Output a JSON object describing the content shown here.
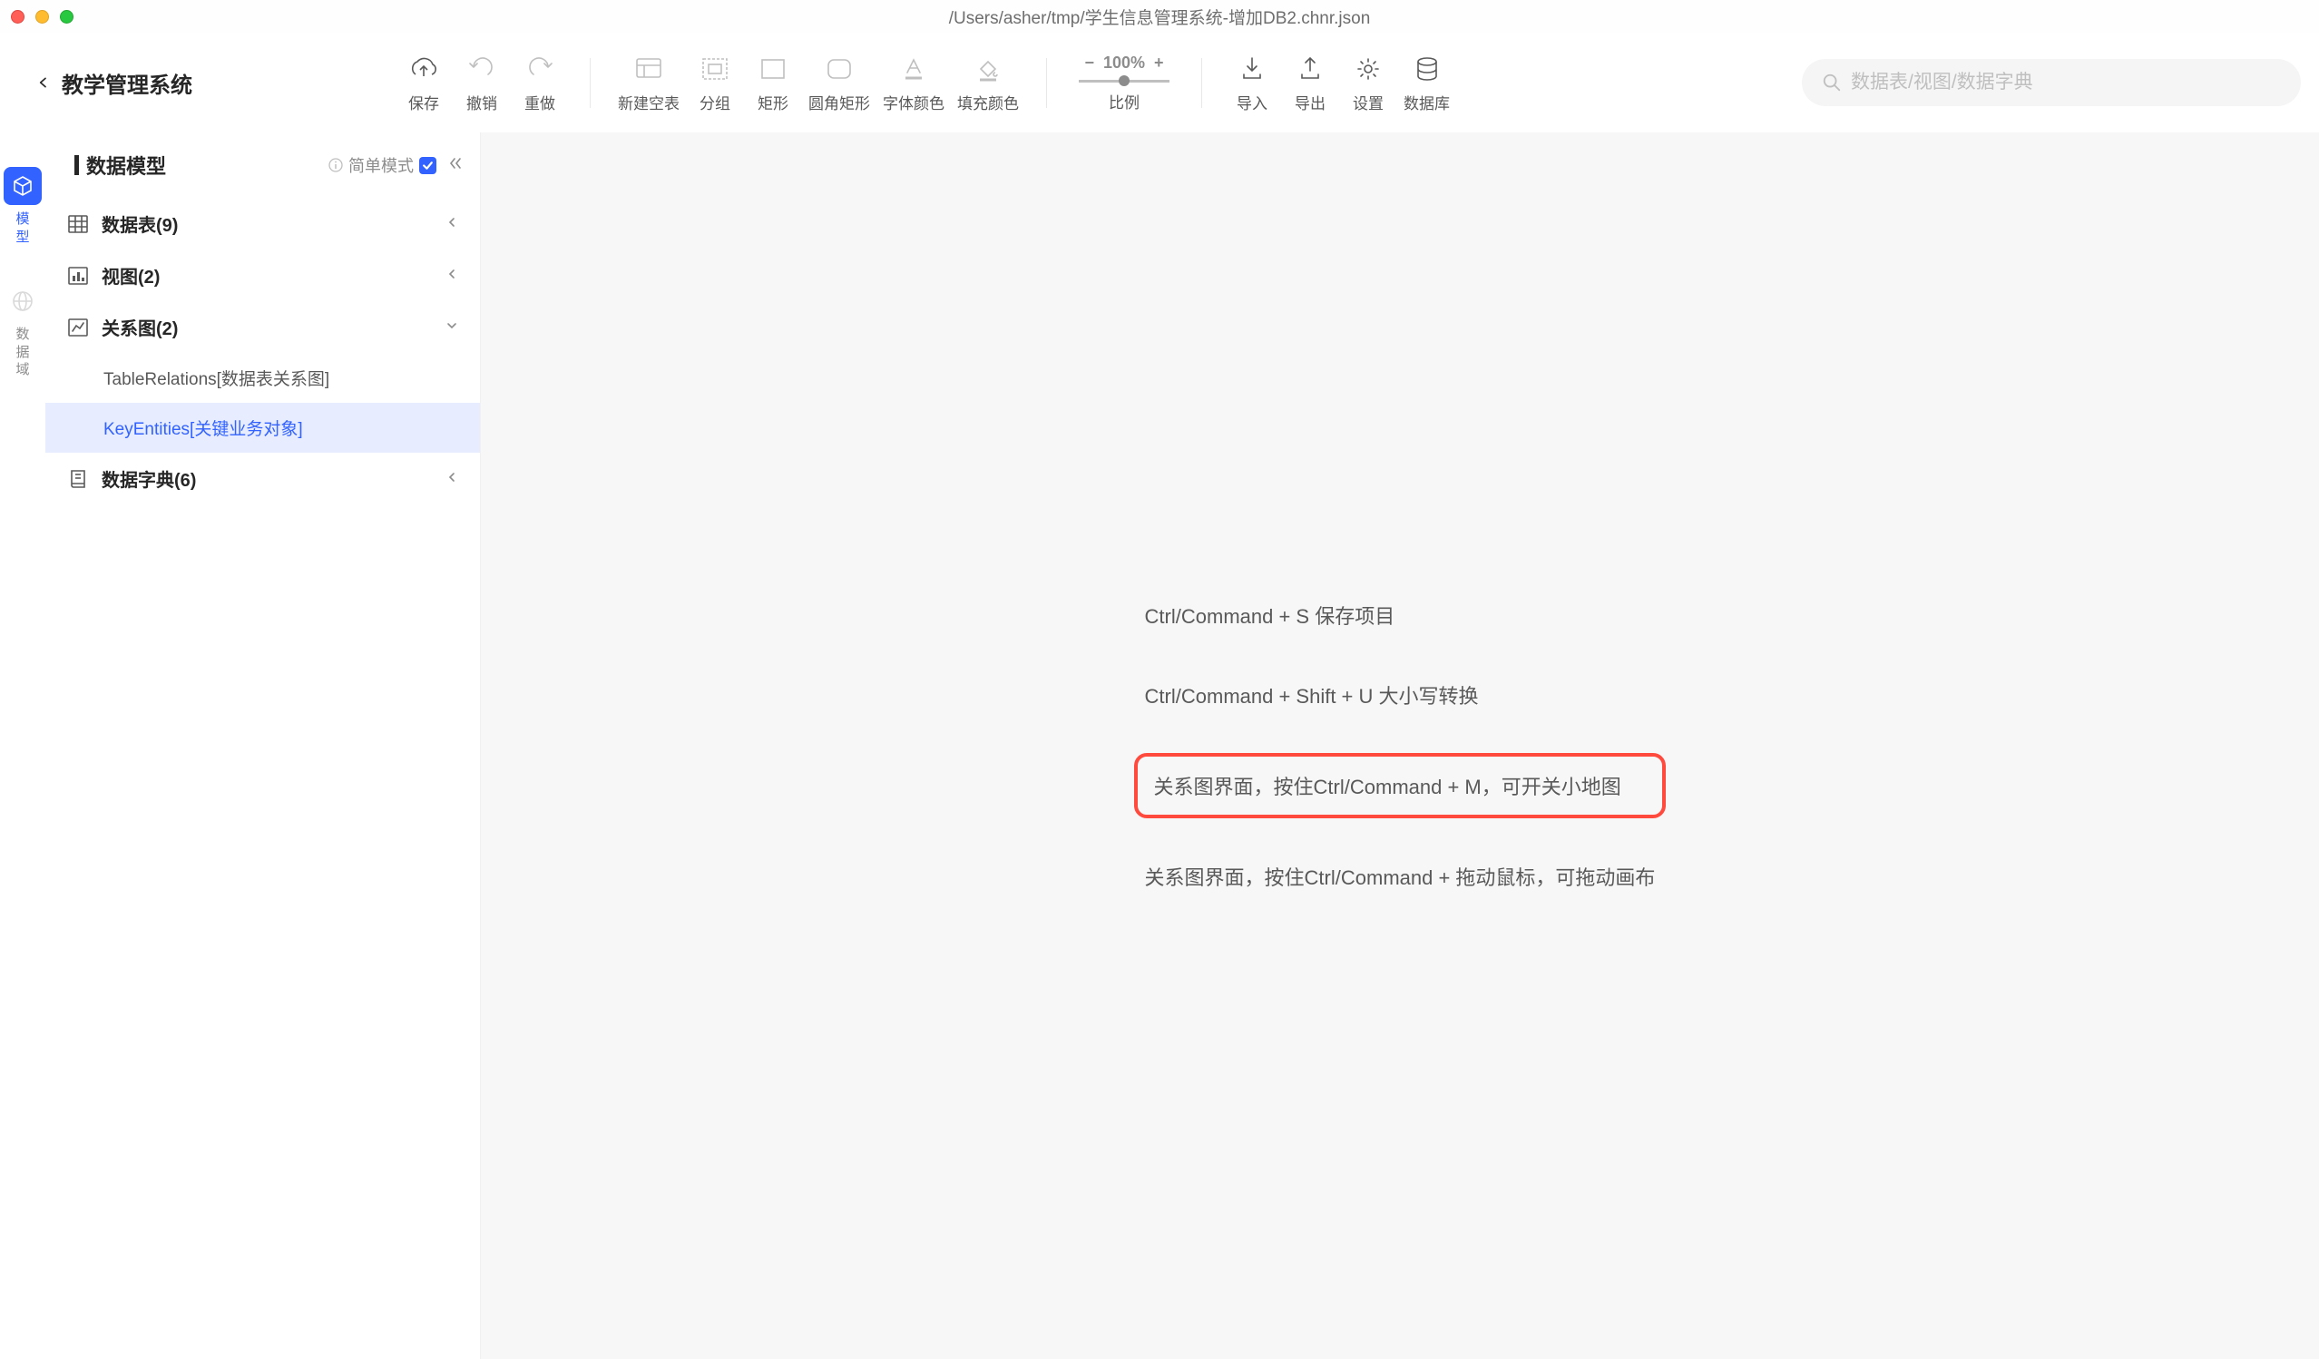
{
  "window": {
    "title": "/Users/asher/tmp/学生信息管理系统-增加DB2.chnr.json"
  },
  "project": {
    "name": "教学管理系统"
  },
  "toolbar": {
    "save": "保存",
    "undo": "撤销",
    "redo": "重做",
    "new_table": "新建空表",
    "group": "分组",
    "rect": "矩形",
    "round_rect": "圆角矩形",
    "font_color": "字体颜色",
    "fill_color": "填充颜色",
    "zoom": {
      "value": "100%",
      "label": "比例",
      "minus": "−",
      "plus": "+"
    },
    "import": "导入",
    "export": "导出",
    "settings": "设置",
    "database": "数据库"
  },
  "search": {
    "placeholder": "数据表/视图/数据字典"
  },
  "left_rail": {
    "model": "模\n型",
    "domain": "数\n据\n域"
  },
  "sidebar": {
    "title": "数据模型",
    "simple_mode_label": "简单模式",
    "tree": {
      "tables": {
        "label": "数据表(9)"
      },
      "views": {
        "label": "视图(2)"
      },
      "relations": {
        "label": "关系图(2)",
        "children": [
          {
            "label": "TableRelations[数据表关系图]",
            "selected": false
          },
          {
            "label": "KeyEntities[关键业务对象]",
            "selected": true
          }
        ]
      },
      "dicts": {
        "label": "数据字典(6)"
      }
    }
  },
  "canvas": {
    "hints": [
      "Ctrl/Command + S 保存项目",
      "Ctrl/Command + Shift + U 大小写转换",
      "关系图界面，按住Ctrl/Command + M，可开关小地图",
      "关系图界面，按住Ctrl/Command + 拖动鼠标，可拖动画布"
    ],
    "highlighted_index": 2
  }
}
